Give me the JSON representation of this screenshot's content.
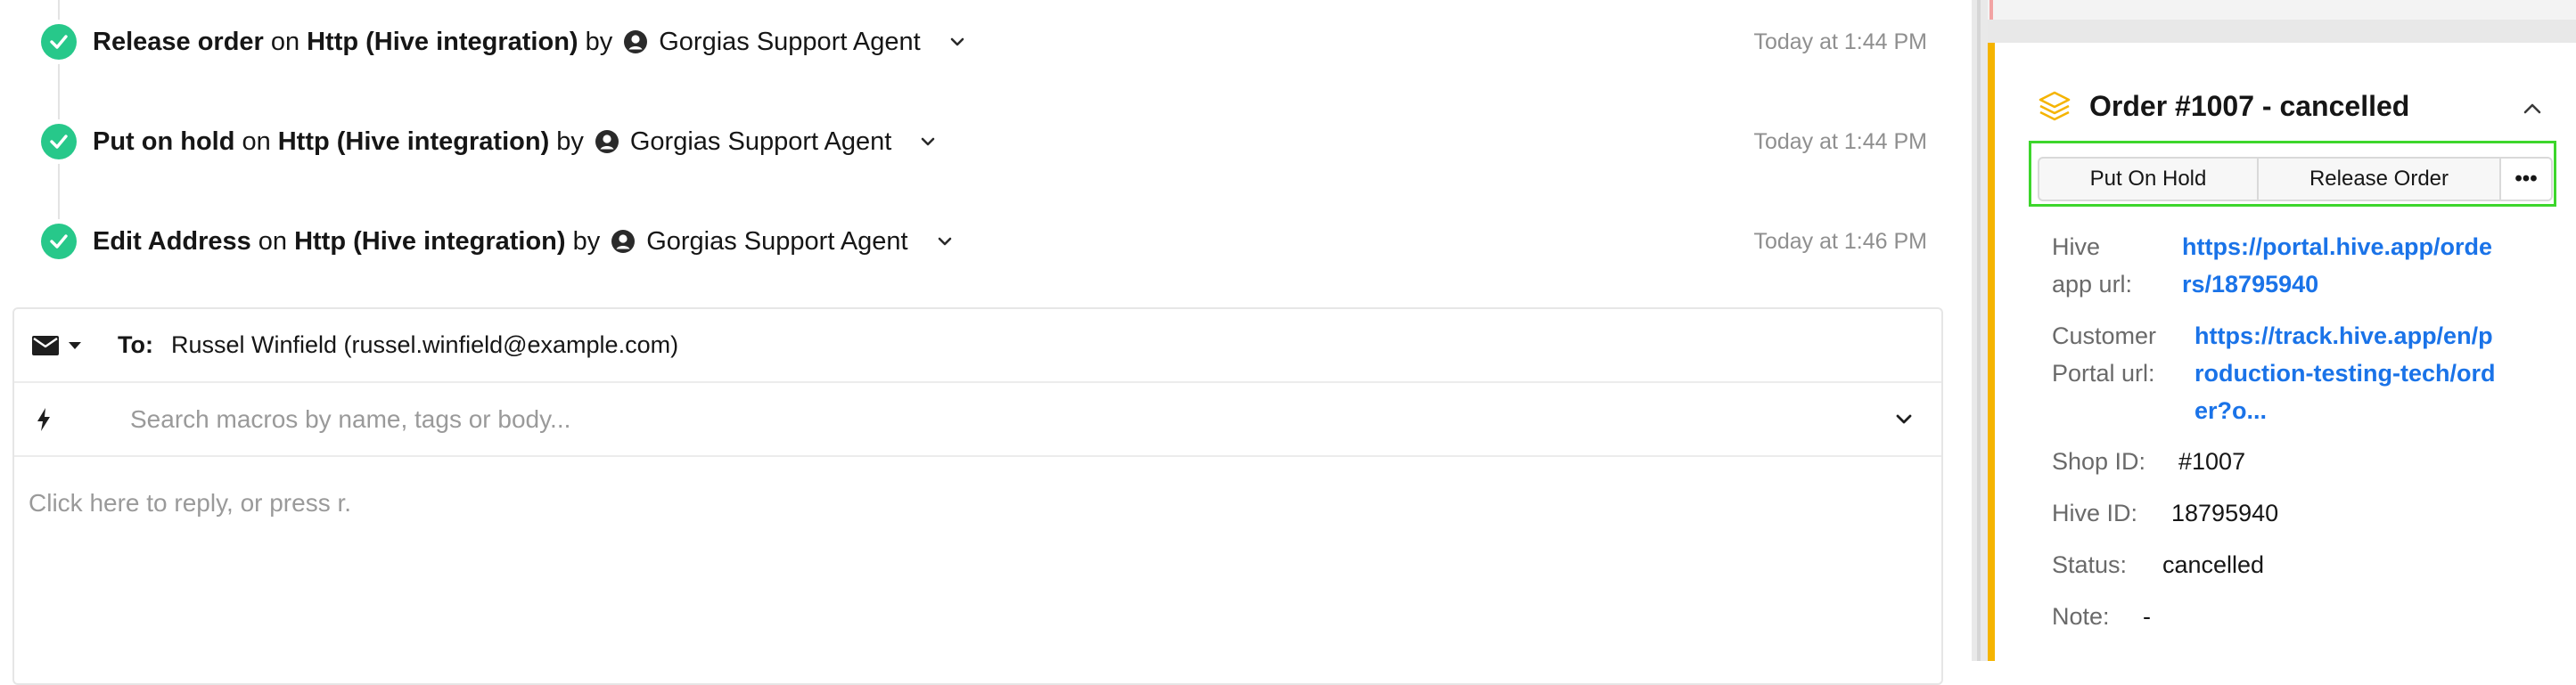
{
  "events": [
    {
      "action": "Release order",
      "on": "on",
      "integration": "Http (Hive integration)",
      "by": "by",
      "agent": "Gorgias Support Agent",
      "time": "Today at 1:44 PM"
    },
    {
      "action": "Put on hold",
      "on": "on",
      "integration": "Http (Hive integration)",
      "by": "by",
      "agent": "Gorgias Support Agent",
      "time": "Today at 1:44 PM"
    },
    {
      "action": "Edit Address",
      "on": "on",
      "integration": "Http (Hive integration)",
      "by": "by",
      "agent": "Gorgias Support Agent",
      "time": "Today at 1:46 PM"
    }
  ],
  "reply": {
    "to_label": "To:",
    "to_value": "Russel Winfield (russel.winfield@example.com)",
    "macro_placeholder": "Search macros by name, tags or body...",
    "reply_placeholder": "Click here to reply, or press r."
  },
  "order": {
    "title": "Order #1007 - cancelled",
    "buttons": {
      "put_on_hold": "Put On Hold",
      "release_order": "Release Order",
      "more": "•••"
    },
    "fields": {
      "hive_app_url_label_1": "Hive",
      "hive_app_url_label_2": "app url:",
      "hive_app_url_1": "https://portal.hive.app/orde",
      "hive_app_url_2": "rs/18795940",
      "customer_portal_label_1": "Customer",
      "customer_portal_label_2": "Portal url:",
      "customer_portal_1": "https://track.hive.app/en/p",
      "customer_portal_2": "roduction-testing-tech/ord",
      "customer_portal_3": "er?o...",
      "shop_id_label": "Shop ID:",
      "shop_id": "#1007",
      "hive_id_label": "Hive ID:",
      "hive_id": "18795940",
      "status_label": "Status:",
      "status": "cancelled",
      "note_label": "Note:",
      "note": "-"
    }
  },
  "colors": {
    "success": "#27c88a",
    "link": "#1a73e8",
    "accent": "#f5b400",
    "focus": "#3dd62c"
  },
  "icons": [
    "check-icon",
    "person-icon",
    "chevron-down-icon",
    "mail-icon",
    "bolt-icon",
    "layers-icon",
    "chevron-up-icon"
  ]
}
